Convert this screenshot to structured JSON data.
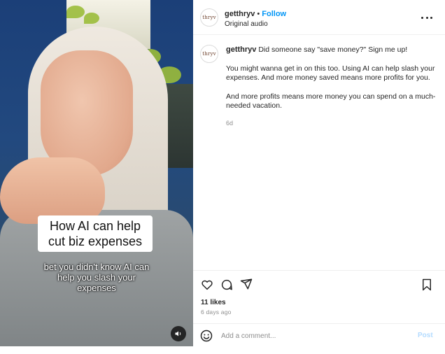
{
  "media": {
    "caption": "How AI can help cut biz expenses",
    "subcaption": "bet you didn't know AI can help you slash your expenses",
    "sound_icon": "speaker-icon"
  },
  "header": {
    "avatar_text": "thryv",
    "username": "getthryv",
    "separator": "•",
    "follow_label": "Follow",
    "audio_label": "Original audio",
    "more_icon": "more-options-icon"
  },
  "post": {
    "avatar_text": "thryv",
    "username": "getthryv",
    "line1": "Did someone say \"save money?\" Sign me up!",
    "paragraph2": "You might wanna get in on this too. Using AI can help slash your expenses. And more money saved means more profits for you.",
    "paragraph3": "And more profits means more money you can spend on a much-needed vacation.",
    "time": "6d"
  },
  "actions": {
    "icons": [
      "heart-icon",
      "comment-icon",
      "share-icon",
      "bookmark-icon"
    ],
    "likes": "11 likes",
    "posted_ago": "6 days ago"
  },
  "comment": {
    "emoji_icon": "emoji-icon",
    "placeholder": "Add a comment...",
    "post_label": "Post"
  },
  "colors": {
    "accent": "#0095f6",
    "post_disabled": "#b3dbff",
    "muted": "#8e8e8e"
  }
}
